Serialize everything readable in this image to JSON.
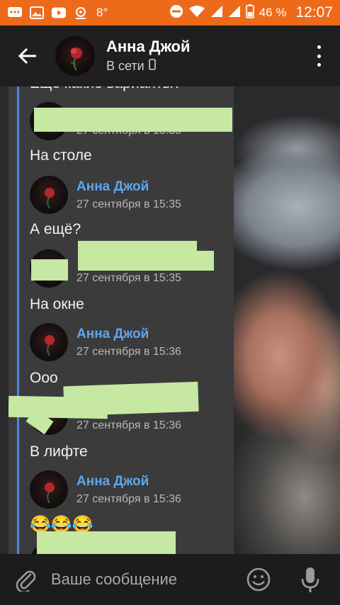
{
  "status_bar": {
    "temperature": "8°",
    "battery": "46 %",
    "time": "12:07",
    "icons": [
      "chat-icon",
      "image-icon",
      "youtube-icon",
      "weather-icon",
      "dnd-icon",
      "wifi-icon",
      "signal-icon",
      "signal-icon",
      "battery-icon"
    ]
  },
  "header": {
    "name": "Анна Джой",
    "status": "В сети"
  },
  "chat": {
    "partial_top_text": "Ещё какие варианты?",
    "messages": [
      {
        "time": "27 сентября в 15:35",
        "text": "На столе"
      },
      {
        "name": "Анна Джой",
        "time": "27 сентября в 15:35",
        "text": "А ещё?"
      },
      {
        "time": "27 сентября в 15:35",
        "text": "На окне"
      },
      {
        "name": "Анна Джой",
        "time": "27 сентября в 15:36",
        "text": "Ооо"
      },
      {
        "time": "27 сентября в 15:36",
        "text": "В лифте"
      },
      {
        "name": "Анна Джой",
        "time": "27 сентября в 15:36",
        "text": "😂😂😂"
      }
    ]
  },
  "input": {
    "placeholder": "Ваше сообщение"
  },
  "colors": {
    "status_bar": "#ee6a1b",
    "accent_name": "#5ea6ec",
    "quote_bar": "#4a86e8",
    "redaction": "#c6e8a2"
  }
}
